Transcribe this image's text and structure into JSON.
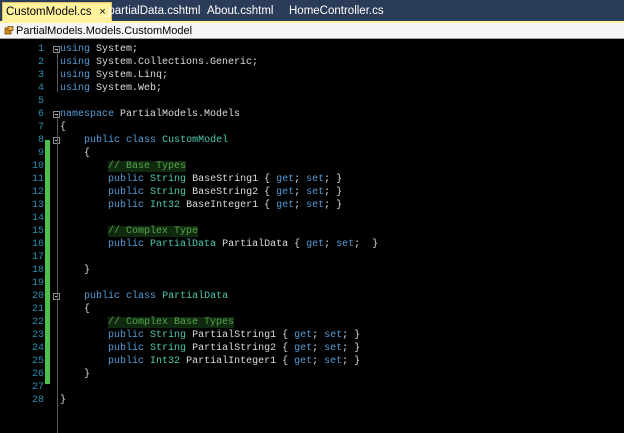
{
  "tabs": [
    {
      "label": "CustomModel.cs",
      "close": "×",
      "active": true
    },
    {
      "label": "_partialData.cshtml",
      "active": false
    },
    {
      "label": "About.cshtml",
      "active": false
    },
    {
      "label": "HomeController.cs",
      "active": false
    }
  ],
  "navbar": {
    "path": "PartialModels.Models.CustomModel",
    "icon": "class-icon"
  },
  "colors": {
    "tab_strip": "#2b3c59",
    "active_tab": "#fff29d",
    "keyword": "#569cd6",
    "type": "#4ec9b0",
    "comment": "#57a64a",
    "line_number": "#2b91af",
    "change_bar": "#4cc24c"
  },
  "editor": {
    "lines": [
      {
        "n": "1",
        "parts": [
          [
            "kw",
            "using"
          ],
          [
            "tx",
            " System;"
          ]
        ]
      },
      {
        "n": "2",
        "parts": [
          [
            "kw",
            "using"
          ],
          [
            "tx",
            " System.Collections.Generic;"
          ]
        ]
      },
      {
        "n": "3",
        "parts": [
          [
            "kw",
            "using"
          ],
          [
            "tx",
            " System.Linq;"
          ]
        ]
      },
      {
        "n": "4",
        "parts": [
          [
            "kw",
            "using"
          ],
          [
            "tx",
            " System.Web;"
          ]
        ]
      },
      {
        "n": "5",
        "parts": []
      },
      {
        "n": "6",
        "parts": [
          [
            "kw",
            "namespace"
          ],
          [
            "tx",
            " PartialModels.Models"
          ]
        ]
      },
      {
        "n": "7",
        "parts": [
          [
            "tx",
            "{"
          ]
        ]
      },
      {
        "n": "8",
        "parts": [
          [
            "tx",
            "    "
          ],
          [
            "kw",
            "public"
          ],
          [
            "tx",
            " "
          ],
          [
            "kw",
            "class"
          ],
          [
            "tx",
            " "
          ],
          [
            "ty",
            "CustomModel"
          ]
        ]
      },
      {
        "n": "9",
        "parts": [
          [
            "tx",
            "    {"
          ]
        ]
      },
      {
        "n": "10",
        "parts": [
          [
            "tx",
            "        "
          ],
          [
            "cm",
            "// Base Types"
          ]
        ]
      },
      {
        "n": "11",
        "parts": [
          [
            "tx",
            "        "
          ],
          [
            "kw",
            "public"
          ],
          [
            "tx",
            " "
          ],
          [
            "ty",
            "String"
          ],
          [
            "tx",
            " BaseString1 { "
          ],
          [
            "kw",
            "get"
          ],
          [
            "tx",
            "; "
          ],
          [
            "kw",
            "set"
          ],
          [
            "tx",
            "; }"
          ]
        ]
      },
      {
        "n": "12",
        "parts": [
          [
            "tx",
            "        "
          ],
          [
            "kw",
            "public"
          ],
          [
            "tx",
            " "
          ],
          [
            "ty",
            "String"
          ],
          [
            "tx",
            " BaseString2 { "
          ],
          [
            "kw",
            "get"
          ],
          [
            "tx",
            "; "
          ],
          [
            "kw",
            "set"
          ],
          [
            "tx",
            "; }"
          ]
        ]
      },
      {
        "n": "13",
        "parts": [
          [
            "tx",
            "        "
          ],
          [
            "kw",
            "public"
          ],
          [
            "tx",
            " "
          ],
          [
            "ty",
            "Int32"
          ],
          [
            "tx",
            " BaseInteger1 { "
          ],
          [
            "kw",
            "get"
          ],
          [
            "tx",
            "; "
          ],
          [
            "kw",
            "set"
          ],
          [
            "tx",
            "; }"
          ]
        ]
      },
      {
        "n": "14",
        "parts": []
      },
      {
        "n": "15",
        "parts": [
          [
            "tx",
            "        "
          ],
          [
            "cm",
            "// Complex Type"
          ]
        ]
      },
      {
        "n": "16",
        "parts": [
          [
            "tx",
            "        "
          ],
          [
            "kw",
            "public"
          ],
          [
            "tx",
            " "
          ],
          [
            "ty",
            "PartialData"
          ],
          [
            "tx",
            " PartialData { "
          ],
          [
            "kw",
            "get"
          ],
          [
            "tx",
            "; "
          ],
          [
            "kw",
            "set"
          ],
          [
            "tx",
            ";  }"
          ]
        ]
      },
      {
        "n": "17",
        "parts": []
      },
      {
        "n": "18",
        "parts": [
          [
            "tx",
            "    }"
          ]
        ]
      },
      {
        "n": "19",
        "parts": []
      },
      {
        "n": "20",
        "parts": [
          [
            "tx",
            "    "
          ],
          [
            "kw",
            "public"
          ],
          [
            "tx",
            " "
          ],
          [
            "kw",
            "class"
          ],
          [
            "tx",
            " "
          ],
          [
            "ty",
            "PartialData"
          ]
        ]
      },
      {
        "n": "21",
        "parts": [
          [
            "tx",
            "    {"
          ]
        ]
      },
      {
        "n": "22",
        "parts": [
          [
            "tx",
            "        "
          ],
          [
            "cm",
            "// Complex Base Types"
          ]
        ]
      },
      {
        "n": "23",
        "parts": [
          [
            "tx",
            "        "
          ],
          [
            "kw",
            "public"
          ],
          [
            "tx",
            " "
          ],
          [
            "ty",
            "String"
          ],
          [
            "tx",
            " PartialString1 { "
          ],
          [
            "kw",
            "get"
          ],
          [
            "tx",
            "; "
          ],
          [
            "kw",
            "set"
          ],
          [
            "tx",
            "; }"
          ]
        ]
      },
      {
        "n": "24",
        "parts": [
          [
            "tx",
            "        "
          ],
          [
            "kw",
            "public"
          ],
          [
            "tx",
            " "
          ],
          [
            "ty",
            "String"
          ],
          [
            "tx",
            " PartialString2 { "
          ],
          [
            "kw",
            "get"
          ],
          [
            "tx",
            "; "
          ],
          [
            "kw",
            "set"
          ],
          [
            "tx",
            "; }"
          ]
        ]
      },
      {
        "n": "25",
        "parts": [
          [
            "tx",
            "        "
          ],
          [
            "kw",
            "public"
          ],
          [
            "tx",
            " "
          ],
          [
            "ty",
            "Int32"
          ],
          [
            "tx",
            " PartialInteger1 { "
          ],
          [
            "kw",
            "get"
          ],
          [
            "tx",
            "; "
          ],
          [
            "kw",
            "set"
          ],
          [
            "tx",
            "; }"
          ]
        ]
      },
      {
        "n": "26",
        "parts": [
          [
            "tx",
            "    }"
          ]
        ]
      },
      {
        "n": "27",
        "parts": []
      },
      {
        "n": "28",
        "parts": [
          [
            "tx",
            "}"
          ]
        ]
      }
    ]
  }
}
